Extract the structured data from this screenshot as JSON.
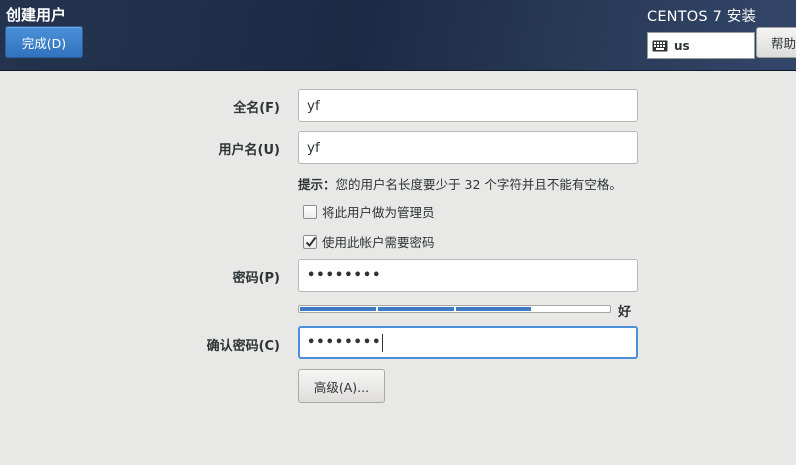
{
  "header": {
    "title": "创建用户",
    "done_label": "完成(D)",
    "product_title": "CENTOS 7 安装",
    "keyboard_layout": "us",
    "help_label": "帮助"
  },
  "form": {
    "fullname_label": "全名(F)",
    "fullname_value": "yf",
    "username_label": "用户名(U)",
    "username_value": "yf",
    "hint_prefix": "提示：",
    "hint_text": "您的用户名长度要少于 32 个字符并且不能有空格。",
    "admin_checkbox_label": "将此用户做为管理员",
    "admin_checked": false,
    "require_password_label": "使用此帐户需要密码",
    "require_password_checked": true,
    "password_label": "密码(P)",
    "password_value": "••••••••",
    "strength_label": "好",
    "strength_level": 0.75,
    "confirm_label": "确认密码(C)",
    "confirm_value": "••••••••",
    "advanced_label": "高级(A)..."
  },
  "colors": {
    "accent": "#4a90d9",
    "header_bg": "#1b2a44",
    "page_bg": "#e8e8e7",
    "strength_fill": "#3d7cc4"
  }
}
